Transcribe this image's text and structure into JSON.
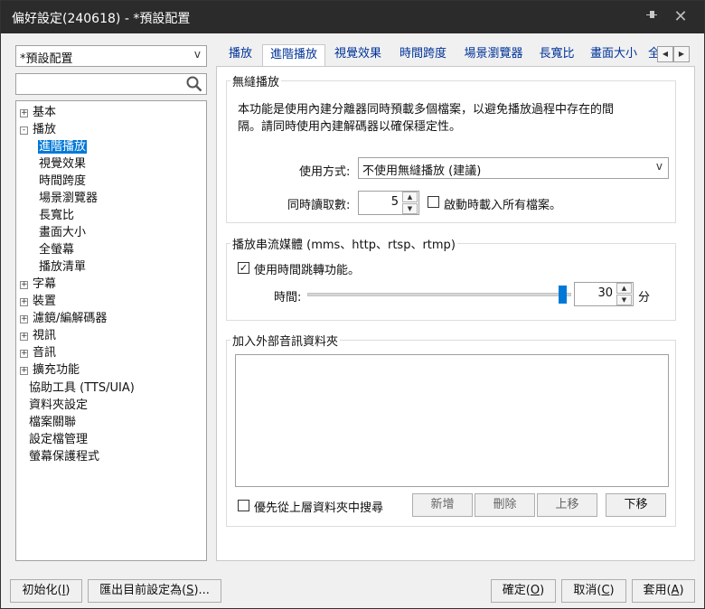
{
  "window": {
    "title": "偏好設定(240618) - *預設配置",
    "pin_icon": "pin-icon",
    "close_icon": "close-icon"
  },
  "profile_select": {
    "value": "*預設配置"
  },
  "search": {
    "placeholder": "",
    "icon": "search-icon"
  },
  "tree": [
    {
      "label": "基本",
      "expander": "+"
    },
    {
      "label": "播放",
      "expander": "-"
    },
    {
      "label": "進階播放",
      "selected": true
    },
    {
      "label": "視覺效果"
    },
    {
      "label": "時間跨度"
    },
    {
      "label": "場景瀏覽器"
    },
    {
      "label": "長寬比"
    },
    {
      "label": "畫面大小"
    },
    {
      "label": "全螢幕"
    },
    {
      "label": "播放清單"
    },
    {
      "label": "字幕",
      "expander": "+"
    },
    {
      "label": "裝置",
      "expander": "+"
    },
    {
      "label": "濾鏡/編解碼器",
      "expander": "+"
    },
    {
      "label": "視訊",
      "expander": "+"
    },
    {
      "label": "音訊",
      "expander": "+"
    },
    {
      "label": "擴充功能",
      "expander": "+"
    },
    {
      "label": "協助工具 (TTS/UIA)"
    },
    {
      "label": "資料夾設定"
    },
    {
      "label": "檔案關聯"
    },
    {
      "label": "設定檔管理"
    },
    {
      "label": "螢幕保護程式"
    }
  ],
  "tabs": [
    "播放",
    "進階播放",
    "視覺效果",
    "時間跨度",
    "場景瀏覽器",
    "長寬比",
    "畫面大小",
    "全"
  ],
  "active_tab": "進階播放",
  "gapless": {
    "title": "無縫播放",
    "description_line1": "本功能是使用內建分離器同時預載多個檔案，以避免播放過程中存在的間",
    "description_line2": "隔。請同時使用內建解碼器以確保穩定性。",
    "mode_label": "使用方式:",
    "mode_value": "不使用無縫播放 (建議)",
    "concurrent_label": "同時讀取數:",
    "concurrent_value": "5",
    "load_all_label": "啟動時載入所有檔案。",
    "load_all_checked": false
  },
  "streaming": {
    "title": "播放串流媒體 (mms、http、rtsp、rtmp)",
    "seek_label": "使用時間跳轉功能。",
    "seek_checked": true,
    "time_label": "時間:",
    "time_value": "30",
    "time_unit": "分",
    "slider_level": 1.0
  },
  "external_audio": {
    "title": "加入外部音訊資料夾",
    "search_parent_label": "優先從上層資料夾中搜尋",
    "search_parent_checked": false,
    "add_label": "新增",
    "delete_label": "刪除",
    "up_label": "上移",
    "down_label": "下移"
  },
  "footer": {
    "init_label": "初始化(",
    "init_key": "I",
    "export_label": "匯出目前設定為(",
    "export_key": "S",
    "export_suffix": ")...",
    "ok_label": "確定(",
    "ok_key": "O",
    "cancel_label": "取消(",
    "cancel_key": "C",
    "apply_label": "套用(",
    "apply_key": "A",
    "close_paren": ")"
  }
}
